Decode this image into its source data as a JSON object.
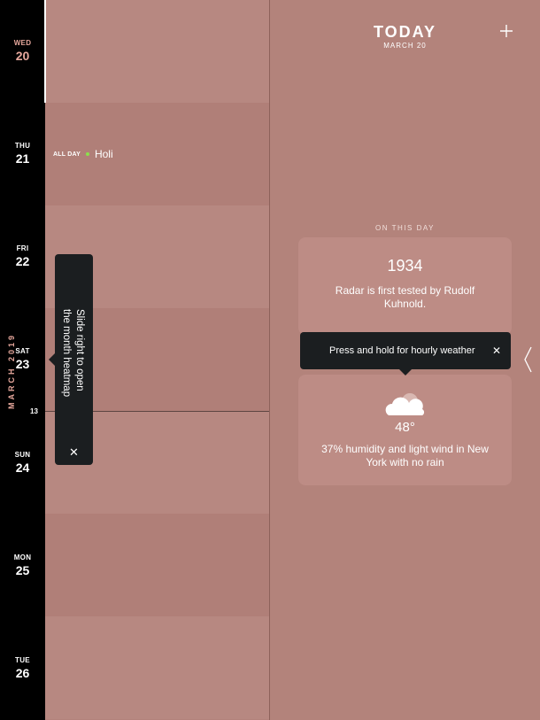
{
  "rail": {
    "days": [
      {
        "dow": "WED",
        "num": "20"
      },
      {
        "dow": "THU",
        "num": "21"
      },
      {
        "dow": "FRI",
        "num": "22"
      },
      {
        "dow": "SAT",
        "num": "23"
      },
      {
        "dow": "SUN",
        "num": "24"
      },
      {
        "dow": "MON",
        "num": "25"
      },
      {
        "dow": "TUE",
        "num": "26"
      }
    ],
    "month": "MARCH 2019",
    "hour_label": "13"
  },
  "events": {
    "all_day_tag": "ALL DAY",
    "holi": "Holi"
  },
  "heatmap_tip": {
    "text": "Slide right to open the month heatmap",
    "close": "✕"
  },
  "header": {
    "title": "TODAY",
    "date": "MARCH 20",
    "add_icon": "plus-icon"
  },
  "on_this_day": {
    "label": "ON THIS DAY",
    "year": "1934",
    "text": "Radar is first tested by Rudolf Kuhnold."
  },
  "weather": {
    "tip": "Press and hold for hourly weather",
    "tip_close": "✕",
    "temp": "48°",
    "summary": "37% humidity and light wind in New York with no rain",
    "icon": "cloud-icon"
  },
  "colors": {
    "background": "#b3837b",
    "accent": "#e6a79c",
    "tooltip": "#1b1e20",
    "event_dot": "#8ae04c"
  }
}
